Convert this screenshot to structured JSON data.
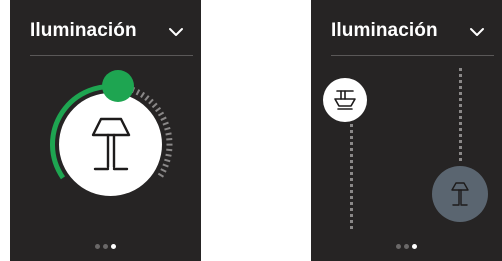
{
  "screens": [
    {
      "title": "Iluminación",
      "dropdown_icon": "chevron-down-icon",
      "control": "circular-dimmer",
      "brightness_percent": 55,
      "lamp_icon": "table-lamp-icon",
      "page_indicator": {
        "count": 3,
        "active": 3
      }
    },
    {
      "title": "Iluminación",
      "dropdown_icon": "chevron-down-icon",
      "control": "up-down-lamp-sliders",
      "uplight_icon": "uplight-lamp-icon",
      "downlight_icon": "table-lamp-icon",
      "page_indicator": {
        "count": 3,
        "active": 3
      }
    }
  ],
  "colors": {
    "panel_bg": "#262424",
    "accent_green": "#1ea551",
    "track_grey": "#8a8888",
    "handle_grey": "#5a6570",
    "text": "#ffffff"
  }
}
